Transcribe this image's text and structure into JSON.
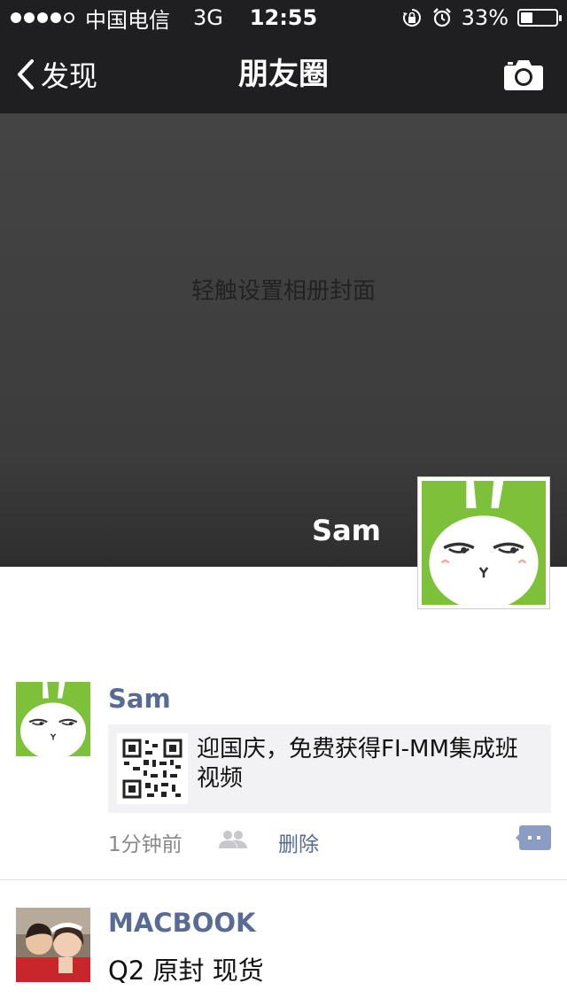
{
  "status_bar": {
    "signal_filled": 4,
    "signal_total": 5,
    "carrier": "中国电信",
    "network": "3G",
    "time": "12:55",
    "icons": [
      "orientation-lock-icon",
      "alarm-icon"
    ],
    "battery_percent_label": "33%",
    "battery_level": 0.33
  },
  "nav": {
    "back_label": "发现",
    "title": "朋友圈",
    "camera_icon": "camera-icon"
  },
  "cover": {
    "hint": "轻触设置相册封面",
    "username": "Sam",
    "avatar_icon": "rabbit-avatar"
  },
  "feed": [
    {
      "name": "Sam",
      "avatar_icon": "rabbit-avatar",
      "link_title": "迎国庆，免费获得FI-MM集成班视频",
      "thumb_icon": "qr-code-icon",
      "time": "1分钟前",
      "privacy_icon": "friends-icon",
      "delete_label": "删除",
      "comment_icon": "comment-icon"
    },
    {
      "name": "MACBOOK",
      "avatar_icon": "couple-photo-avatar",
      "text": "Q2 原封 现货"
    }
  ],
  "colors": {
    "bar_bg": "#1f1f22",
    "cover_bg": "#3f3f3f",
    "name_blue": "#576b95",
    "rabbit_green": "#7dc13b"
  }
}
